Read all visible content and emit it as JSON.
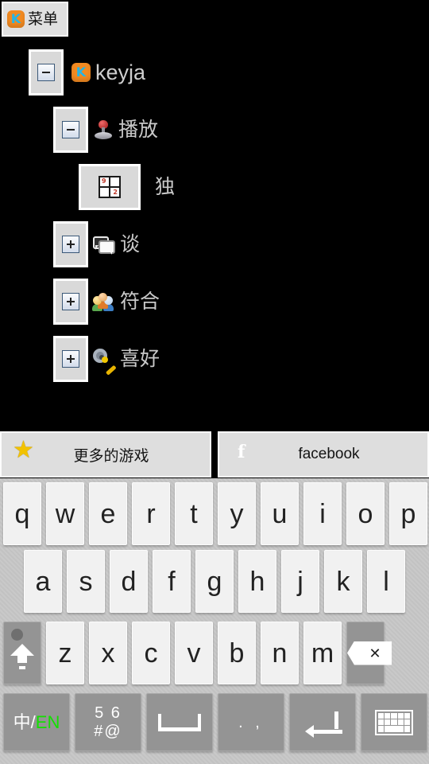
{
  "app": {
    "background_color": "#000000",
    "text_color": "#c9c9c9"
  },
  "menu_button": {
    "label": "菜单",
    "icon": "keyja-k-icon",
    "icon_bg": "#f28a21",
    "icon_fg": "#23b5e8"
  },
  "tree": {
    "items": [
      {
        "label": "keyja",
        "expander": "minus",
        "icon": "keyja-k-icon",
        "depth": 0,
        "selected": false
      },
      {
        "label": "播放",
        "expander": "minus",
        "icon": "joystick-icon",
        "depth": 1,
        "selected": false
      },
      {
        "label": "独",
        "expander": "none",
        "icon": "sudoku-grid-icon",
        "depth": 2,
        "selected": true
      },
      {
        "label": "谈",
        "expander": "plus",
        "icon": "chat-bubbles-icon",
        "depth": 1,
        "selected": false
      },
      {
        "label": "符合",
        "expander": "plus",
        "icon": "people-group-icon",
        "depth": 1,
        "selected": false
      },
      {
        "label": "喜好",
        "expander": "plus",
        "icon": "gear-wrench-icon",
        "depth": 1,
        "selected": false
      }
    ]
  },
  "banners": [
    {
      "label": "更多的游戏",
      "icon": "star-icon"
    },
    {
      "label": "facebook",
      "icon": "facebook-icon",
      "icon_color": "#3b5998"
    }
  ],
  "keyboard": {
    "row1": [
      "q",
      "w",
      "e",
      "r",
      "t",
      "y",
      "u",
      "i",
      "o",
      "p"
    ],
    "row2": [
      "a",
      "s",
      "d",
      "f",
      "g",
      "h",
      "j",
      "k",
      "l"
    ],
    "row3": [
      "z",
      "x",
      "c",
      "v",
      "b",
      "n",
      "m"
    ],
    "shift_key": {
      "name": "shift",
      "icon": "shift-arrow-icon"
    },
    "backspace_key": {
      "name": "backspace",
      "icon": "backspace-icon"
    },
    "row4": [
      {
        "name": "language-toggle",
        "label_cn": "中/",
        "label_en": "EN",
        "en_color": "#12e000"
      },
      {
        "name": "symbols",
        "line1": "5 6",
        "line2": "#@"
      },
      {
        "name": "space",
        "icon": "space-bar-icon"
      },
      {
        "name": "punctuation",
        "label": ". ,"
      },
      {
        "name": "enter",
        "icon": "enter-arrow-icon"
      },
      {
        "name": "hide-keyboard",
        "icon": "keyboard-icon"
      }
    ]
  }
}
